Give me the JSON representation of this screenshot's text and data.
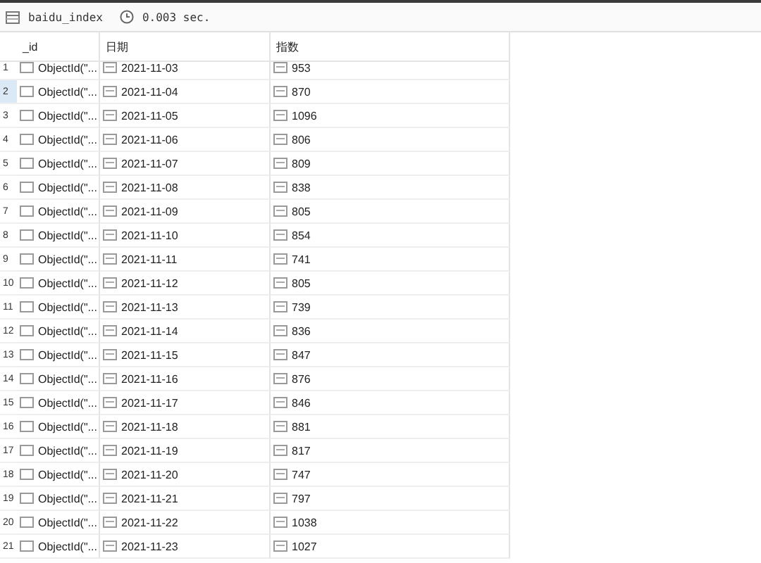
{
  "toolbar": {
    "collection": "baidu_index",
    "time": "0.003 sec."
  },
  "table": {
    "columns": [
      "_id",
      "日期",
      "指数"
    ],
    "rows": [
      {
        "number": "1",
        "id": "ObjectId(\"...",
        "date": "2021-11-03",
        "value": "953",
        "selected": false
      },
      {
        "number": "2",
        "id": "ObjectId(\"...",
        "date": "2021-11-04",
        "value": "870",
        "selected": true
      },
      {
        "number": "3",
        "id": "ObjectId(\"...",
        "date": "2021-11-05",
        "value": "1096",
        "selected": false
      },
      {
        "number": "4",
        "id": "ObjectId(\"...",
        "date": "2021-11-06",
        "value": "806",
        "selected": false
      },
      {
        "number": "5",
        "id": "ObjectId(\"...",
        "date": "2021-11-07",
        "value": "809",
        "selected": false
      },
      {
        "number": "6",
        "id": "ObjectId(\"...",
        "date": "2021-11-08",
        "value": "838",
        "selected": false
      },
      {
        "number": "7",
        "id": "ObjectId(\"...",
        "date": "2021-11-09",
        "value": "805",
        "selected": false
      },
      {
        "number": "8",
        "id": "ObjectId(\"...",
        "date": "2021-11-10",
        "value": "854",
        "selected": false
      },
      {
        "number": "9",
        "id": "ObjectId(\"...",
        "date": "2021-11-11",
        "value": "741",
        "selected": false
      },
      {
        "number": "10",
        "id": "ObjectId(\"...",
        "date": "2021-11-12",
        "value": "805",
        "selected": false
      },
      {
        "number": "11",
        "id": "ObjectId(\"...",
        "date": "2021-11-13",
        "value": "739",
        "selected": false
      },
      {
        "number": "12",
        "id": "ObjectId(\"...",
        "date": "2021-11-14",
        "value": "836",
        "selected": false
      },
      {
        "number": "13",
        "id": "ObjectId(\"...",
        "date": "2021-11-15",
        "value": "847",
        "selected": false
      },
      {
        "number": "14",
        "id": "ObjectId(\"...",
        "date": "2021-11-16",
        "value": "876",
        "selected": false
      },
      {
        "number": "15",
        "id": "ObjectId(\"...",
        "date": "2021-11-17",
        "value": "846",
        "selected": false
      },
      {
        "number": "16",
        "id": "ObjectId(\"...",
        "date": "2021-11-18",
        "value": "881",
        "selected": false
      },
      {
        "number": "17",
        "id": "ObjectId(\"...",
        "date": "2021-11-19",
        "value": "817",
        "selected": false
      },
      {
        "number": "18",
        "id": "ObjectId(\"...",
        "date": "2021-11-20",
        "value": "747",
        "selected": false
      },
      {
        "number": "19",
        "id": "ObjectId(\"...",
        "date": "2021-11-21",
        "value": "797",
        "selected": false
      },
      {
        "number": "20",
        "id": "ObjectId(\"...",
        "date": "2021-11-22",
        "value": "1038",
        "selected": false
      },
      {
        "number": "21",
        "id": "ObjectId(\"...",
        "date": "2021-11-23",
        "value": "1027",
        "selected": false
      }
    ]
  }
}
